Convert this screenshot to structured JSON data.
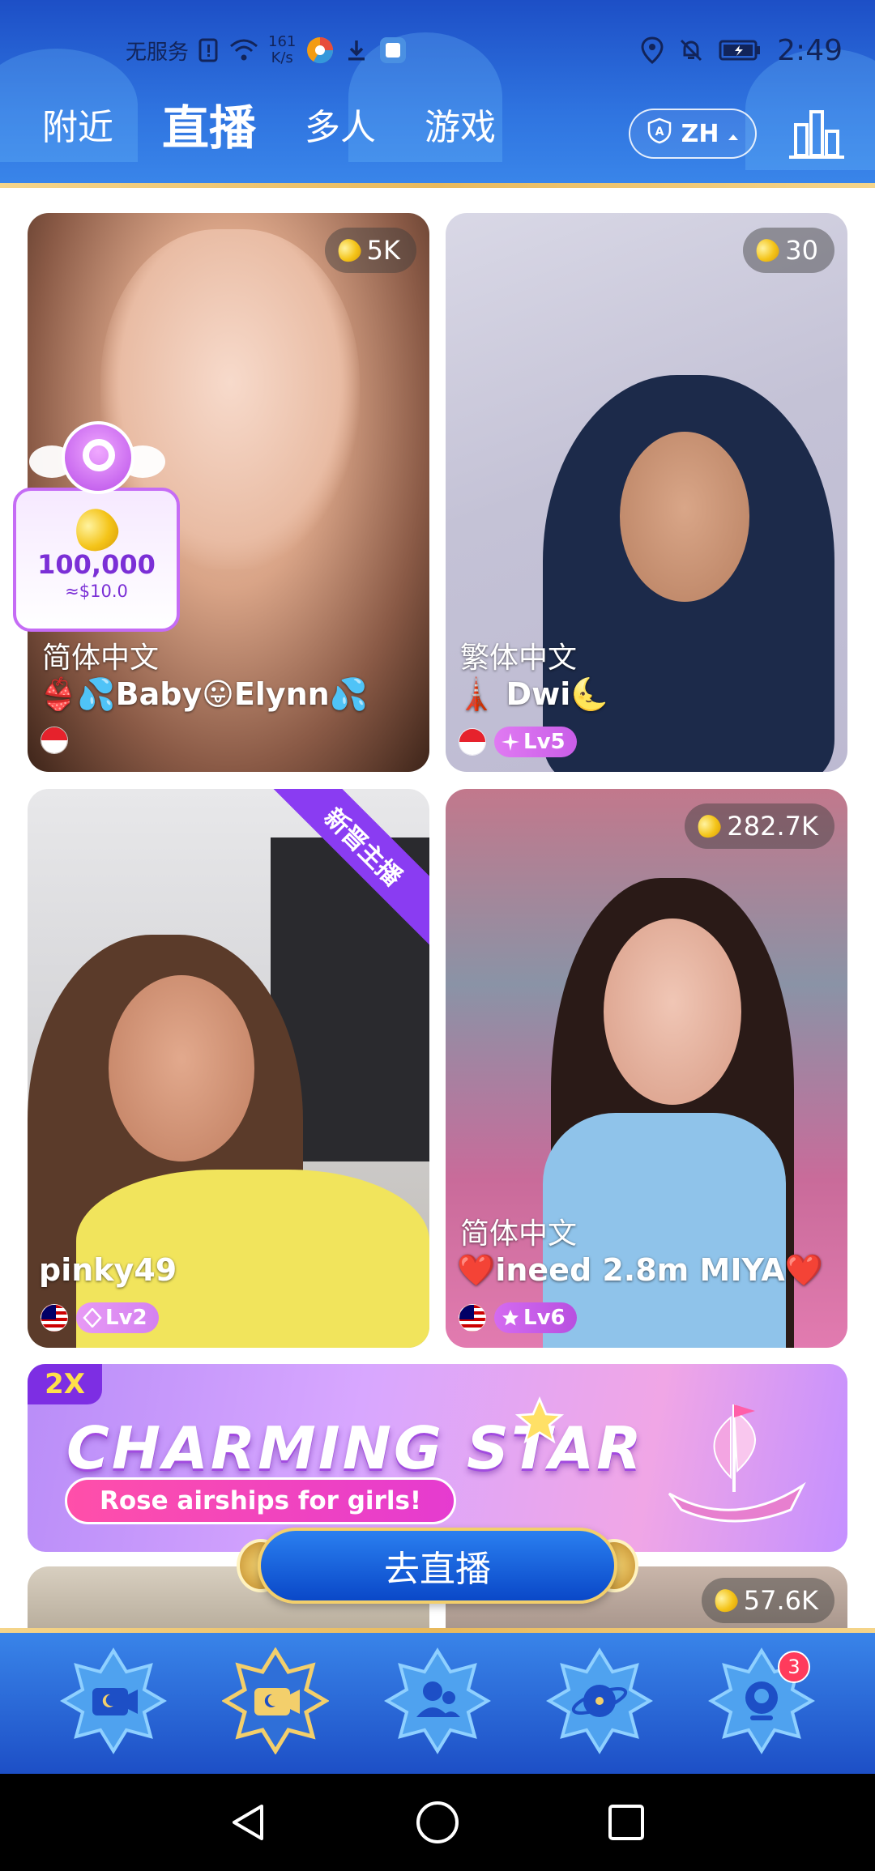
{
  "status_bar": {
    "no_service": "无服务",
    "net_speed_value": "161",
    "net_speed_unit": "K/s",
    "time": "2:49"
  },
  "header": {
    "tabs": [
      {
        "label": "附近"
      },
      {
        "label": "直播"
      },
      {
        "label": "多人"
      },
      {
        "label": "游戏"
      }
    ],
    "active_tab": "直播",
    "language": "ZH"
  },
  "cards": [
    {
      "count": "5K",
      "language": "简体中文",
      "name": "👙💦Baby😛Elynn💦",
      "flag": "singapore-flag",
      "level": ""
    },
    {
      "count": "30",
      "language": "繁体中文",
      "name": "🗼 Dwi🌜",
      "flag": "indonesia-flag",
      "level": "Lv5"
    },
    {
      "count": "",
      "language": "",
      "name": "pinky49",
      "flag": "malaysia-flag",
      "level": "Lv2",
      "ribbon": "新晋主播"
    },
    {
      "count": "282.7K",
      "language": "简体中文",
      "name": "❤️ineed 2.8m  MIYA❤️",
      "flag": "malaysia-flag",
      "level": "Lv6"
    }
  ],
  "gift_popup": {
    "amount": "100,000",
    "usd": "≈$10.0"
  },
  "banner": {
    "tag": "2X",
    "title": "CHARMING STAR",
    "subtitle": "Rose airships for girls!"
  },
  "peek_card": {
    "count": "57.6K"
  },
  "go_live_button": {
    "label": "去直播"
  },
  "bottom_nav": {
    "items": [
      {
        "icon": "live-camera-icon"
      },
      {
        "icon": "live-camera-active-icon"
      },
      {
        "icon": "users-icon"
      },
      {
        "icon": "planet-icon"
      },
      {
        "icon": "profile-icon",
        "badge": "3"
      }
    ]
  },
  "colors": {
    "header_blue": "#2f74e0",
    "gold": "#f3cf6b",
    "purple_ribbon": "#8a3cf2",
    "level_pink": "#d978f2"
  }
}
